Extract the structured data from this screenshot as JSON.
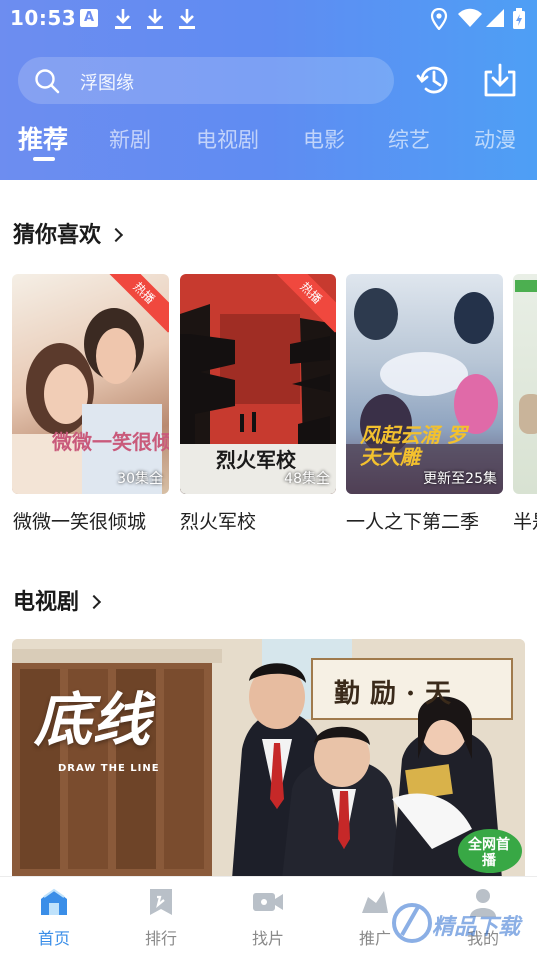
{
  "status_bar": {
    "time": "10:53",
    "icons": [
      "notification-a-icon",
      "download-icon",
      "download-icon",
      "download-icon",
      "location-icon",
      "wifi-icon",
      "signal-icon",
      "battery-icon"
    ]
  },
  "search": {
    "placeholder": "浮图缘"
  },
  "header_buttons": [
    "history-icon",
    "download-icon"
  ],
  "tabs": [
    {
      "label": "推荐",
      "active": true
    },
    {
      "label": "新剧",
      "active": false
    },
    {
      "label": "电视剧",
      "active": false
    },
    {
      "label": "电影",
      "active": false
    },
    {
      "label": "综艺",
      "active": false
    },
    {
      "label": "动漫",
      "active": false
    }
  ],
  "section_guess": {
    "title": "猜你喜欢",
    "items": [
      {
        "caption": "微微一笑很倾城",
        "badge": "热播",
        "episodes": "30集全",
        "art_title": "微微一笑很倾城"
      },
      {
        "caption": "烈火军校",
        "badge": "热播",
        "episodes": "48集全",
        "art_title": "烈火军校"
      },
      {
        "caption": "一人之下第二季",
        "badge": "",
        "episodes": "更新至25集",
        "art_title": "风起云涌 罗天大雕"
      },
      {
        "caption": "半是",
        "badge": "",
        "episodes": "",
        "art_title": ""
      }
    ]
  },
  "section_tv": {
    "title": "电视剧",
    "banner": {
      "art_title": "底线",
      "art_subtitle": "DRAW THE LINE",
      "calligraphy": "勤励·天",
      "stamp": "全网首播"
    }
  },
  "bottom_nav": [
    {
      "label": "首页",
      "icon": "home-icon",
      "active": true
    },
    {
      "label": "排行",
      "icon": "ranking-icon",
      "active": false
    },
    {
      "label": "找片",
      "icon": "video-camera-icon",
      "active": false
    },
    {
      "label": "推广",
      "icon": "share-icon",
      "active": false
    },
    {
      "label": "我的",
      "icon": "user-icon",
      "active": false
    }
  ],
  "watermark": "精品下载",
  "colors": {
    "header_start": "#6d8df0",
    "header_end": "#4e9ff5",
    "accent": "#3a8ee8",
    "badge": "#f0483e"
  }
}
